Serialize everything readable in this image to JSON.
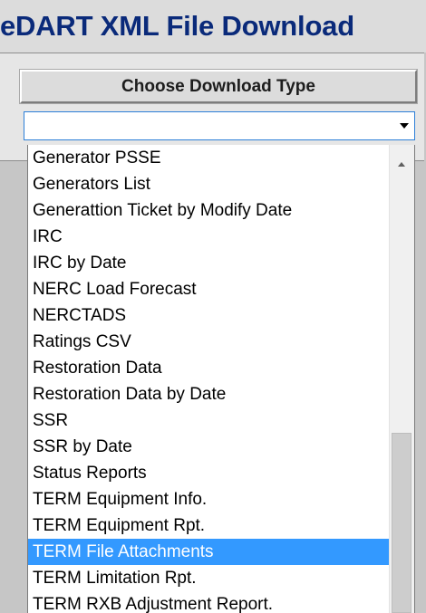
{
  "app": {
    "title": "eDART XML File Download"
  },
  "form": {
    "header": "Choose Download Type",
    "select_value": ""
  },
  "dropdown": {
    "options": [
      "Generator PSSE",
      "Generators List",
      "Generattion Ticket by Modify Date",
      "IRC",
      "IRC by Date",
      "NERC Load Forecast",
      "NERCTADS",
      "Ratings CSV",
      "Restoration Data",
      "Restoration Data by Date",
      "SSR",
      "SSR by Date",
      "Status Reports",
      "TERM Equipment Info.",
      "TERM Equipment Rpt.",
      "TERM File Attachments",
      "TERM Limitation Rpt.",
      "TERM RXB Adjustment Report."
    ],
    "selected": "TERM File Attachments"
  },
  "icons": {
    "select_arrow": "chevron-down-icon",
    "scroll_up": "scroll-up-icon"
  },
  "colors": {
    "title": "#0a2a7a",
    "highlight": "#3399ff",
    "focus_border": "#2c7fd8"
  }
}
